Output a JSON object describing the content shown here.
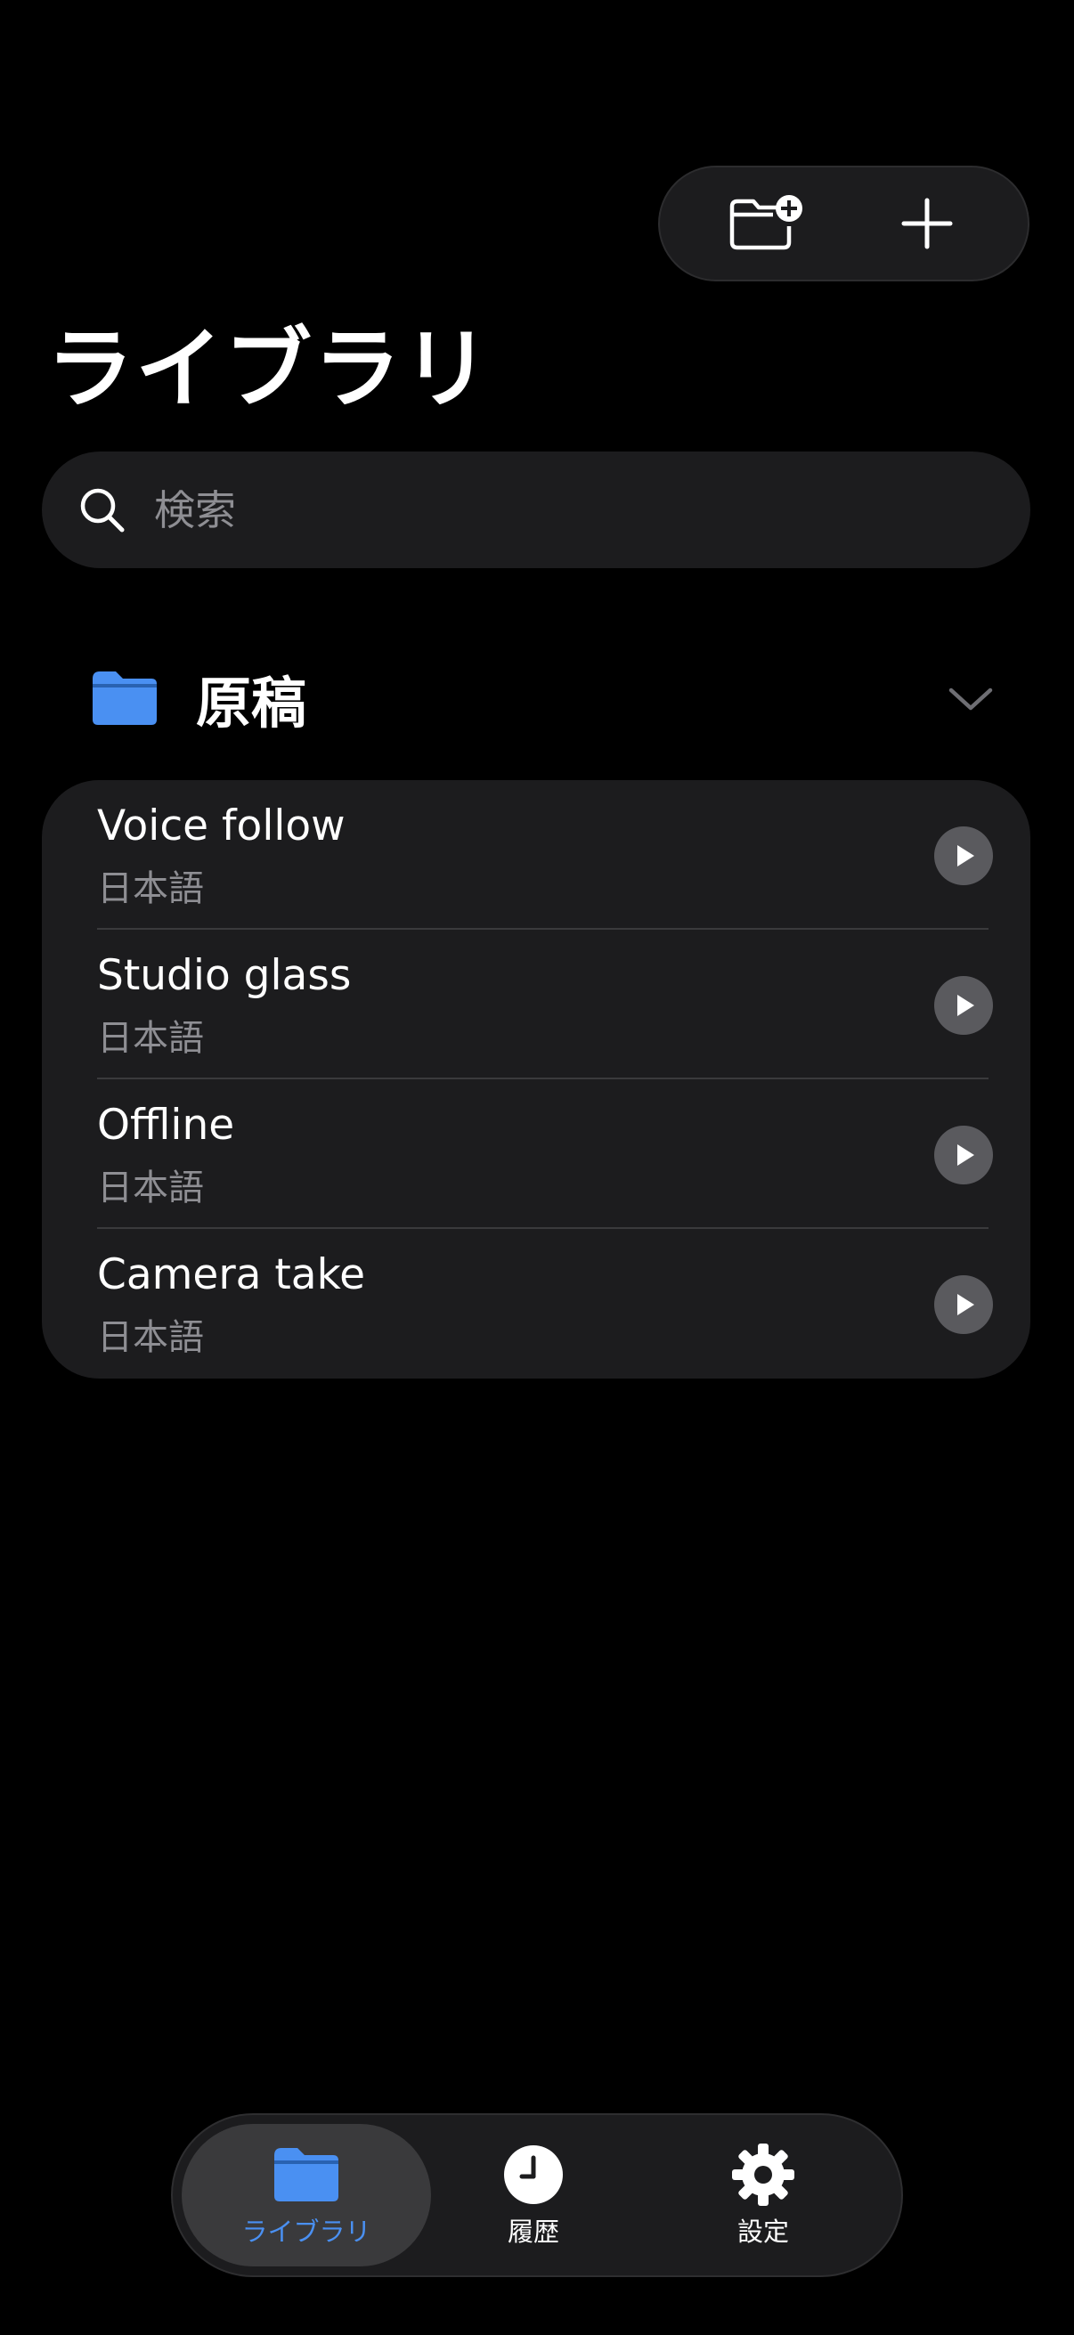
{
  "header": {
    "title": "ライブラリ",
    "actions": [
      {
        "id": "new-folder",
        "icon": "folder-badge-plus-icon"
      },
      {
        "id": "add",
        "icon": "plus-icon"
      }
    ]
  },
  "search": {
    "placeholder": "検索",
    "value": "",
    "icon": "search-icon"
  },
  "folder": {
    "name": "原稿",
    "icon": "folder-icon",
    "expanded_icon": "chevron-down-icon",
    "color": "#4a90f2"
  },
  "items": [
    {
      "title": "Voice follow",
      "language": "日本語"
    },
    {
      "title": "Studio glass",
      "language": "日本語"
    },
    {
      "title": "Offline",
      "language": "日本語"
    },
    {
      "title": "Camera take",
      "language": "日本語"
    }
  ],
  "tabbar": {
    "active": 0,
    "accent": "#4a90f2",
    "tabs": [
      {
        "label": "ライブラリ",
        "icon": "folder-icon"
      },
      {
        "label": "履歴",
        "icon": "clock-icon"
      },
      {
        "label": "設定",
        "icon": "gear-icon"
      }
    ]
  }
}
